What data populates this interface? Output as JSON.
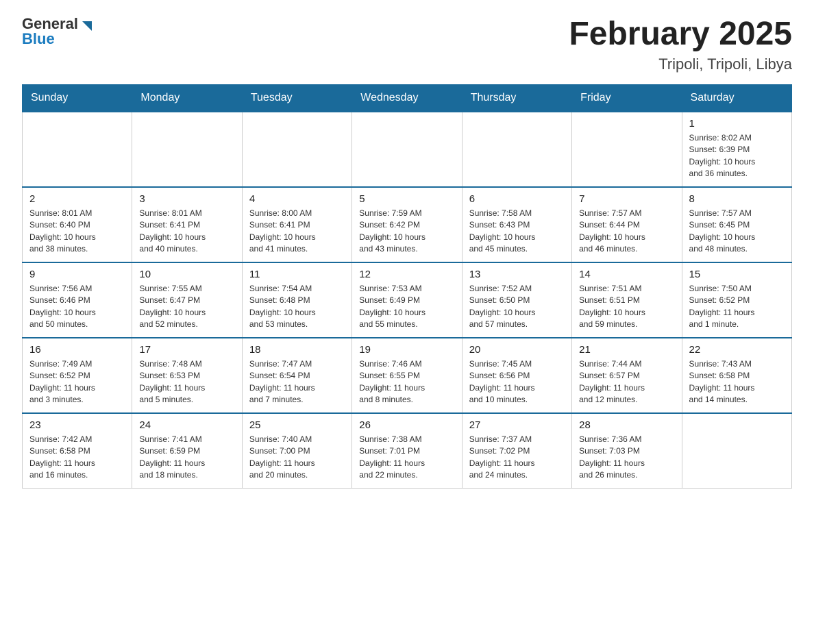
{
  "header": {
    "logo_general": "General",
    "logo_blue": "Blue",
    "month": "February 2025",
    "location": "Tripoli, Tripoli, Libya"
  },
  "weekdays": [
    "Sunday",
    "Monday",
    "Tuesday",
    "Wednesday",
    "Thursday",
    "Friday",
    "Saturday"
  ],
  "weeks": [
    [
      {
        "day": "",
        "info": ""
      },
      {
        "day": "",
        "info": ""
      },
      {
        "day": "",
        "info": ""
      },
      {
        "day": "",
        "info": ""
      },
      {
        "day": "",
        "info": ""
      },
      {
        "day": "",
        "info": ""
      },
      {
        "day": "1",
        "info": "Sunrise: 8:02 AM\nSunset: 6:39 PM\nDaylight: 10 hours\nand 36 minutes."
      }
    ],
    [
      {
        "day": "2",
        "info": "Sunrise: 8:01 AM\nSunset: 6:40 PM\nDaylight: 10 hours\nand 38 minutes."
      },
      {
        "day": "3",
        "info": "Sunrise: 8:01 AM\nSunset: 6:41 PM\nDaylight: 10 hours\nand 40 minutes."
      },
      {
        "day": "4",
        "info": "Sunrise: 8:00 AM\nSunset: 6:41 PM\nDaylight: 10 hours\nand 41 minutes."
      },
      {
        "day": "5",
        "info": "Sunrise: 7:59 AM\nSunset: 6:42 PM\nDaylight: 10 hours\nand 43 minutes."
      },
      {
        "day": "6",
        "info": "Sunrise: 7:58 AM\nSunset: 6:43 PM\nDaylight: 10 hours\nand 45 minutes."
      },
      {
        "day": "7",
        "info": "Sunrise: 7:57 AM\nSunset: 6:44 PM\nDaylight: 10 hours\nand 46 minutes."
      },
      {
        "day": "8",
        "info": "Sunrise: 7:57 AM\nSunset: 6:45 PM\nDaylight: 10 hours\nand 48 minutes."
      }
    ],
    [
      {
        "day": "9",
        "info": "Sunrise: 7:56 AM\nSunset: 6:46 PM\nDaylight: 10 hours\nand 50 minutes."
      },
      {
        "day": "10",
        "info": "Sunrise: 7:55 AM\nSunset: 6:47 PM\nDaylight: 10 hours\nand 52 minutes."
      },
      {
        "day": "11",
        "info": "Sunrise: 7:54 AM\nSunset: 6:48 PM\nDaylight: 10 hours\nand 53 minutes."
      },
      {
        "day": "12",
        "info": "Sunrise: 7:53 AM\nSunset: 6:49 PM\nDaylight: 10 hours\nand 55 minutes."
      },
      {
        "day": "13",
        "info": "Sunrise: 7:52 AM\nSunset: 6:50 PM\nDaylight: 10 hours\nand 57 minutes."
      },
      {
        "day": "14",
        "info": "Sunrise: 7:51 AM\nSunset: 6:51 PM\nDaylight: 10 hours\nand 59 minutes."
      },
      {
        "day": "15",
        "info": "Sunrise: 7:50 AM\nSunset: 6:52 PM\nDaylight: 11 hours\nand 1 minute."
      }
    ],
    [
      {
        "day": "16",
        "info": "Sunrise: 7:49 AM\nSunset: 6:52 PM\nDaylight: 11 hours\nand 3 minutes."
      },
      {
        "day": "17",
        "info": "Sunrise: 7:48 AM\nSunset: 6:53 PM\nDaylight: 11 hours\nand 5 minutes."
      },
      {
        "day": "18",
        "info": "Sunrise: 7:47 AM\nSunset: 6:54 PM\nDaylight: 11 hours\nand 7 minutes."
      },
      {
        "day": "19",
        "info": "Sunrise: 7:46 AM\nSunset: 6:55 PM\nDaylight: 11 hours\nand 8 minutes."
      },
      {
        "day": "20",
        "info": "Sunrise: 7:45 AM\nSunset: 6:56 PM\nDaylight: 11 hours\nand 10 minutes."
      },
      {
        "day": "21",
        "info": "Sunrise: 7:44 AM\nSunset: 6:57 PM\nDaylight: 11 hours\nand 12 minutes."
      },
      {
        "day": "22",
        "info": "Sunrise: 7:43 AM\nSunset: 6:58 PM\nDaylight: 11 hours\nand 14 minutes."
      }
    ],
    [
      {
        "day": "23",
        "info": "Sunrise: 7:42 AM\nSunset: 6:58 PM\nDaylight: 11 hours\nand 16 minutes."
      },
      {
        "day": "24",
        "info": "Sunrise: 7:41 AM\nSunset: 6:59 PM\nDaylight: 11 hours\nand 18 minutes."
      },
      {
        "day": "25",
        "info": "Sunrise: 7:40 AM\nSunset: 7:00 PM\nDaylight: 11 hours\nand 20 minutes."
      },
      {
        "day": "26",
        "info": "Sunrise: 7:38 AM\nSunset: 7:01 PM\nDaylight: 11 hours\nand 22 minutes."
      },
      {
        "day": "27",
        "info": "Sunrise: 7:37 AM\nSunset: 7:02 PM\nDaylight: 11 hours\nand 24 minutes."
      },
      {
        "day": "28",
        "info": "Sunrise: 7:36 AM\nSunset: 7:03 PM\nDaylight: 11 hours\nand 26 minutes."
      },
      {
        "day": "",
        "info": ""
      }
    ]
  ]
}
